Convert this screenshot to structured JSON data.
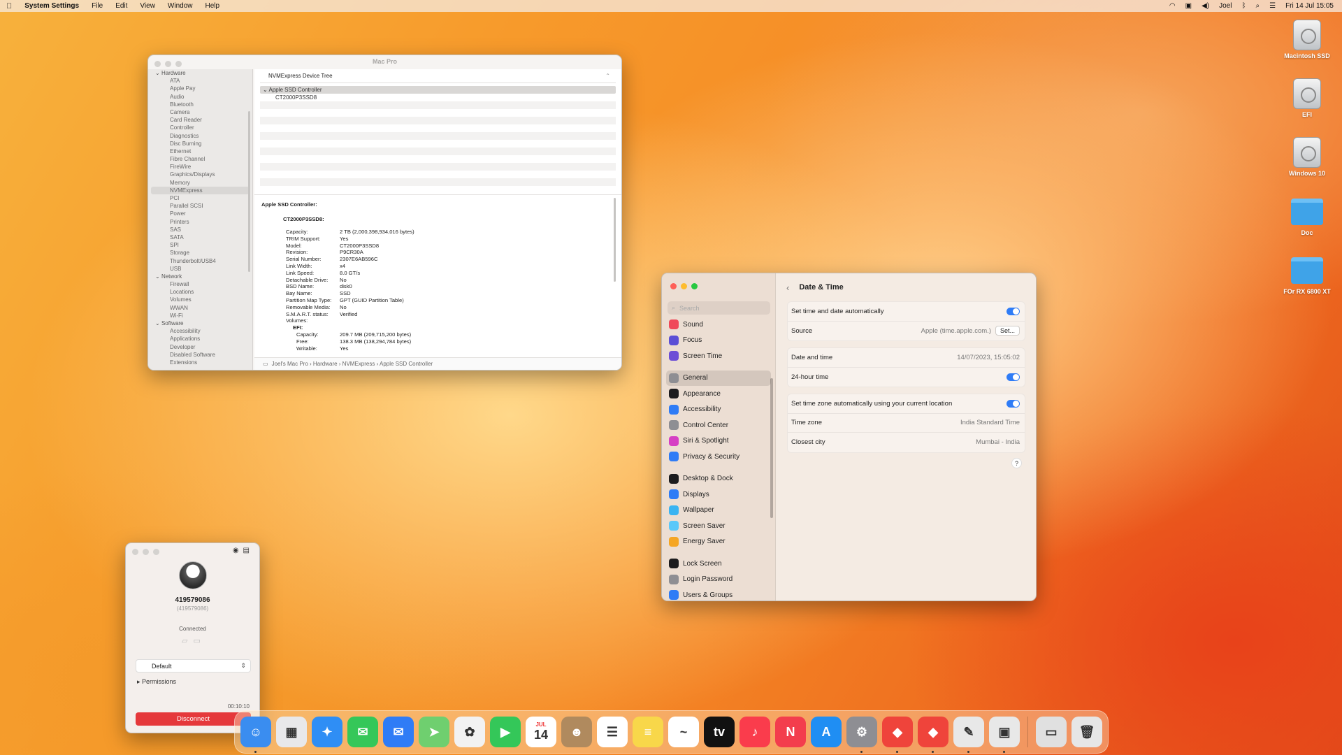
{
  "menubar": {
    "app": "System Settings",
    "menus": [
      "File",
      "Edit",
      "View",
      "Window",
      "Help"
    ],
    "user": "Joel",
    "datetime": "Fri 14 Jul  15:05"
  },
  "desktop_icons": [
    {
      "label": "Macintosh SSD",
      "kind": "drive"
    },
    {
      "label": "EFI",
      "kind": "drive"
    },
    {
      "label": "Windows 10",
      "kind": "drive"
    },
    {
      "label": "Doc",
      "kind": "folder"
    },
    {
      "label": "FOr RX 6800 XT",
      "kind": "folder"
    }
  ],
  "sysinfo": {
    "title": "Mac Pro",
    "sidebar": {
      "hardware_label": "Hardware",
      "hardware": [
        "ATA",
        "Apple Pay",
        "Audio",
        "Bluetooth",
        "Camera",
        "Card Reader",
        "Controller",
        "Diagnostics",
        "Disc Burning",
        "Ethernet",
        "Fibre Channel",
        "FireWire",
        "Graphics/Displays",
        "Memory",
        "NVMExpress",
        "PCI",
        "Parallel SCSI",
        "Power",
        "Printers",
        "SAS",
        "SATA",
        "SPI",
        "Storage",
        "Thunderbolt/USB4",
        "USB"
      ],
      "selected": "NVMExpress",
      "network_label": "Network",
      "network": [
        "Firewall",
        "Locations",
        "Volumes",
        "WWAN",
        "Wi-Fi"
      ],
      "software_label": "Software",
      "software": [
        "Accessibility",
        "Applications",
        "Developer",
        "Disabled Software",
        "Extensions"
      ]
    },
    "tree_header": "NVMExpress Device Tree",
    "tree": [
      "Apple SSD Controller",
      "CT2000P3SSD8"
    ],
    "detail": {
      "heading": "Apple SSD Controller:",
      "device": "CT2000P3SSD8:",
      "fields": [
        [
          "Capacity:",
          "2 TB (2,000,398,934,016 bytes)"
        ],
        [
          "TRIM Support:",
          "Yes"
        ],
        [
          "Model:",
          "CT2000P3SSD8"
        ],
        [
          "Revision:",
          "P9CR30A"
        ],
        [
          "Serial Number:",
          "2307E6AB596C"
        ],
        [
          "Link Width:",
          "x4"
        ],
        [
          "Link Speed:",
          "8.0 GT/s"
        ],
        [
          "Detachable Drive:",
          "No"
        ],
        [
          "BSD Name:",
          "disk0"
        ],
        [
          "Bay Name:",
          "SSD"
        ],
        [
          "Partition Map Type:",
          "GPT (GUID Partition Table)"
        ],
        [
          "Removable Media:",
          "No"
        ],
        [
          "S.M.A.R.T. status:",
          "Verified"
        ],
        [
          "Volumes:",
          ""
        ]
      ],
      "efi_label": "EFI:",
      "efi_fields": [
        [
          "Capacity:",
          "209.7 MB (209,715,200 bytes)"
        ],
        [
          "Free:",
          "138.3 MB (138,294,784 bytes)"
        ],
        [
          "Writable:",
          "Yes"
        ]
      ]
    },
    "path": "Joel's Mac Pro  ›  Hardware  ›  NVMExpress  ›  Apple SSD Controller"
  },
  "settings": {
    "search_placeholder": "Search",
    "nav": [
      {
        "label": "Sound",
        "color": "#ef4a5a",
        "icon": "speaker-icon"
      },
      {
        "label": "Focus",
        "color": "#5b4fd6",
        "icon": "moon-icon"
      },
      {
        "label": "Screen Time",
        "color": "#6d4fd6",
        "icon": "hourglass-icon"
      },
      {
        "label": "General",
        "color": "#8e8e93",
        "icon": "gear-icon",
        "gap_before": true,
        "selected": true
      },
      {
        "label": "Appearance",
        "color": "#1c1c1e",
        "icon": "appearance-icon"
      },
      {
        "label": "Accessibility",
        "color": "#2f7cf6",
        "icon": "accessibility-icon"
      },
      {
        "label": "Control Center",
        "color": "#8e8e93",
        "icon": "control-center-icon"
      },
      {
        "label": "Siri & Spotlight",
        "color": "#d63fc4",
        "icon": "siri-icon"
      },
      {
        "label": "Privacy & Security",
        "color": "#2f7cf6",
        "icon": "hand-icon"
      },
      {
        "label": "Desktop & Dock",
        "color": "#1c1c1e",
        "icon": "dock-icon",
        "gap_before": true
      },
      {
        "label": "Displays",
        "color": "#2f7cf6",
        "icon": "sun-icon"
      },
      {
        "label": "Wallpaper",
        "color": "#3ab4f2",
        "icon": "wallpaper-icon"
      },
      {
        "label": "Screen Saver",
        "color": "#5ac8fa",
        "icon": "screensaver-icon"
      },
      {
        "label": "Energy Saver",
        "color": "#f5a623",
        "icon": "battery-icon"
      },
      {
        "label": "Lock Screen",
        "color": "#1c1c1e",
        "icon": "lock-icon",
        "gap_before": true
      },
      {
        "label": "Login Password",
        "color": "#8e8e93",
        "icon": "key-icon"
      },
      {
        "label": "Users & Groups",
        "color": "#2f7cf6",
        "icon": "users-icon"
      }
    ],
    "title": "Date & Time",
    "group1": {
      "auto_label": "Set time and date automatically",
      "source_label": "Source",
      "source_value": "Apple (time.apple.com.)",
      "set_button": "Set..."
    },
    "group2": {
      "date_label": "Date and time",
      "date_value": "14/07/2023, 15:05:02",
      "h24_label": "24-hour time"
    },
    "group3": {
      "tz_auto_label": "Set time zone automatically using your current location",
      "tz_label": "Time zone",
      "tz_value": "India Standard Time",
      "city_label": "Closest city",
      "city_value": "Mumbai - India"
    },
    "help": "?"
  },
  "anydesk": {
    "id": "419579086",
    "id_sub": "(419579086)",
    "status": "Connected",
    "profile": "Default",
    "permissions": "Permissions",
    "timer": "00:10:10",
    "disconnect": "Disconnect"
  },
  "dock": [
    {
      "name": "finder",
      "color": "#3a8df0",
      "glyph": "☺"
    },
    {
      "name": "launchpad",
      "color": "#e8e8ea",
      "glyph": "▦"
    },
    {
      "name": "safari",
      "color": "#2f8ef5",
      "glyph": "✦"
    },
    {
      "name": "messages",
      "color": "#35c759",
      "glyph": "✉"
    },
    {
      "name": "mail",
      "color": "#2f7cf6",
      "glyph": "✉"
    },
    {
      "name": "maps",
      "color": "#6fcf6f",
      "glyph": "➤"
    },
    {
      "name": "photos",
      "color": "#f2f2f2",
      "glyph": "✿"
    },
    {
      "name": "facetime",
      "color": "#34c759",
      "glyph": "▶"
    },
    {
      "name": "calendar",
      "color": "#ffffff",
      "glyph": "14",
      "label": "JUL"
    },
    {
      "name": "contacts",
      "color": "#b08a5e",
      "glyph": "☻"
    },
    {
      "name": "reminders",
      "color": "#ffffff",
      "glyph": "☰"
    },
    {
      "name": "notes",
      "color": "#f8d74a",
      "glyph": "≡"
    },
    {
      "name": "freeform",
      "color": "#ffffff",
      "glyph": "~"
    },
    {
      "name": "appletv",
      "color": "#111111",
      "glyph": "tv"
    },
    {
      "name": "music",
      "color": "#fa3c4c",
      "glyph": "♪"
    },
    {
      "name": "news",
      "color": "#f33d4d",
      "glyph": "N"
    },
    {
      "name": "appstore",
      "color": "#1f8ef3",
      "glyph": "A"
    },
    {
      "name": "system-settings",
      "color": "#8e8e93",
      "glyph": "⚙"
    },
    {
      "name": "anydesk",
      "color": "#ef443b",
      "glyph": "◆"
    },
    {
      "name": "anydesk-session",
      "color": "#ef443b",
      "glyph": "◆"
    },
    {
      "name": "script-editor",
      "color": "#e8e8e8",
      "glyph": "✎"
    },
    {
      "name": "system-information",
      "color": "#e8e8e8",
      "glyph": "▣"
    },
    {
      "name": "downloads",
      "color": "#e0e0e0",
      "glyph": "▭"
    },
    {
      "name": "trash",
      "color": "#e6e6e6",
      "glyph": "🗑"
    }
  ]
}
